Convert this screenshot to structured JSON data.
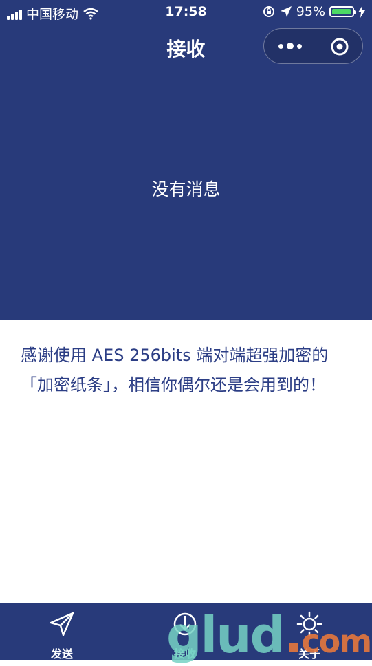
{
  "status_bar": {
    "carrier": "中国移动",
    "time": "17:58",
    "battery_percent": "95%",
    "battery_level": 0.95
  },
  "nav": {
    "title": "接收"
  },
  "main": {
    "empty_message": "没有消息",
    "notice": "感谢使用 AES 256bits 端对端超强加密的「加密纸条」，相信你偶尔还是会用到的！"
  },
  "tabs": [
    {
      "label": "发送",
      "icon": "send-icon",
      "active": false
    },
    {
      "label": "接收",
      "icon": "receive-icon",
      "active": true
    },
    {
      "label": "关于",
      "icon": "sun-icon",
      "active": false
    }
  ],
  "watermark": {
    "text_main": "glud",
    "text_dot": ".",
    "text_com": "com"
  },
  "colors": {
    "primary": "#283a7a",
    "notice_text": "#2c3e85",
    "battery": "#4cd964",
    "active_tab": "#7fd3c8"
  }
}
